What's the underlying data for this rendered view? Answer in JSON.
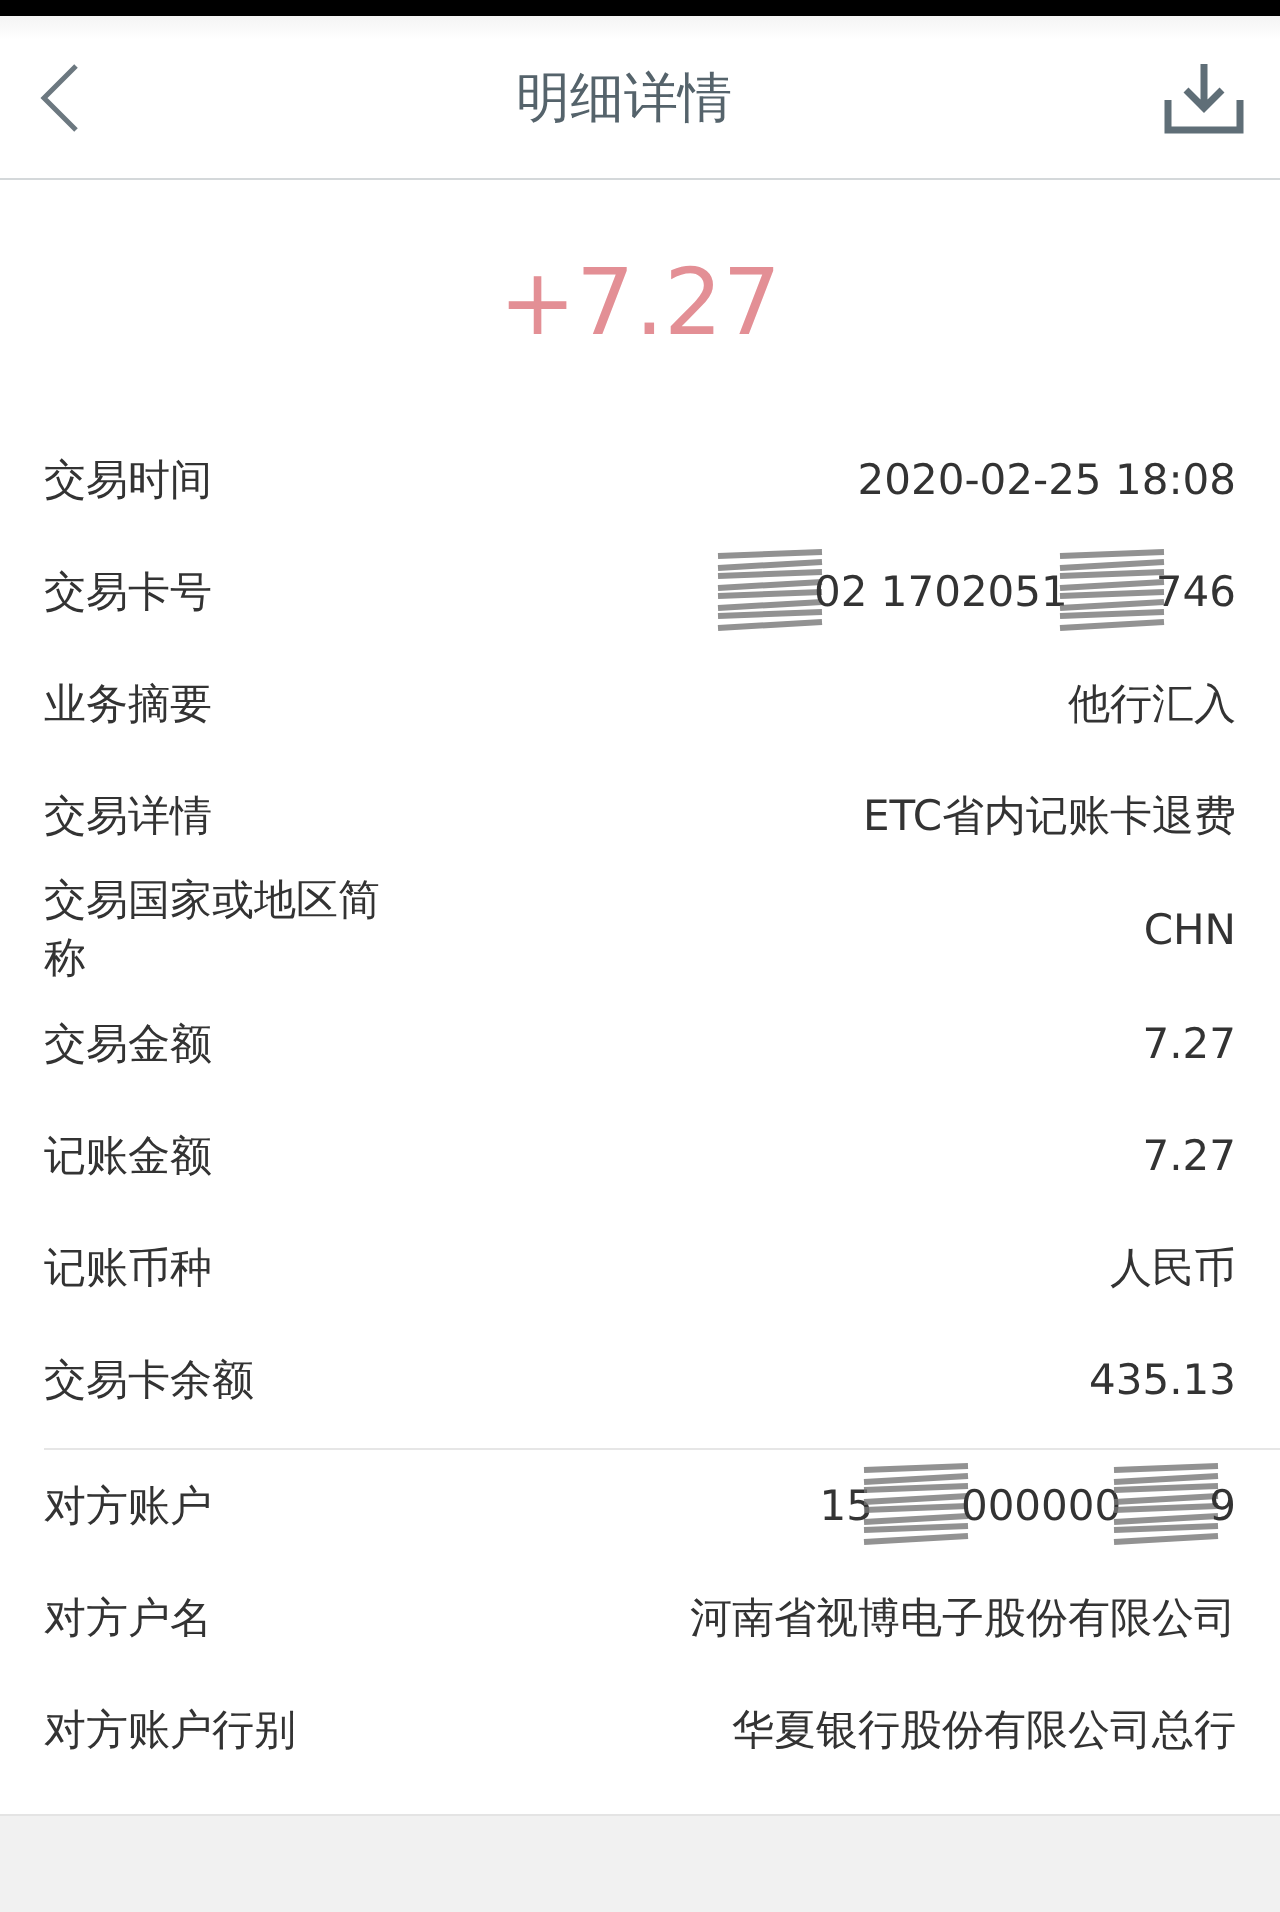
{
  "header": {
    "title": "明细详情"
  },
  "amount": "+7.27",
  "groups": [
    {
      "rows": [
        {
          "label": "交易时间",
          "segments": [
            {
              "kind": "text",
              "text": "2020-02-25 18:08"
            }
          ]
        },
        {
          "label": "交易卡号",
          "segments": [
            {
              "kind": "scribble"
            },
            {
              "kind": "text",
              "text": "02 1702051"
            },
            {
              "kind": "scribble"
            },
            {
              "kind": "text",
              "text": "746"
            }
          ]
        },
        {
          "label": "业务摘要",
          "segments": [
            {
              "kind": "text",
              "text": "他行汇入"
            }
          ]
        },
        {
          "label": "交易详情",
          "segments": [
            {
              "kind": "text",
              "text": "ETC省内记账卡退费"
            }
          ]
        },
        {
          "label": "交易国家或地区简称",
          "segments": [
            {
              "kind": "text",
              "text": "CHN"
            }
          ]
        },
        {
          "label": "交易金额",
          "segments": [
            {
              "kind": "text",
              "text": "7.27"
            }
          ]
        },
        {
          "label": "记账金额",
          "segments": [
            {
              "kind": "text",
              "text": "7.27"
            }
          ]
        },
        {
          "label": "记账币种",
          "segments": [
            {
              "kind": "text",
              "text": "人民币"
            }
          ]
        },
        {
          "label": "交易卡余额",
          "segments": [
            {
              "kind": "text",
              "text": "435.13"
            }
          ]
        }
      ]
    },
    {
      "rows": [
        {
          "label": "对方账户",
          "segments": [
            {
              "kind": "text",
              "text": "15"
            },
            {
              "kind": "scribble"
            },
            {
              "kind": "text",
              "text": "000000"
            },
            {
              "kind": "scribble"
            },
            {
              "kind": "text",
              "text": "9"
            }
          ]
        },
        {
          "label": "对方户名",
          "segments": [
            {
              "kind": "text",
              "text": "河南省视博电子股份有限公司"
            }
          ]
        },
        {
          "label": "对方账户行别",
          "segments": [
            {
              "kind": "text",
              "text": "华夏银行股份有限公司总行"
            }
          ]
        }
      ]
    }
  ]
}
